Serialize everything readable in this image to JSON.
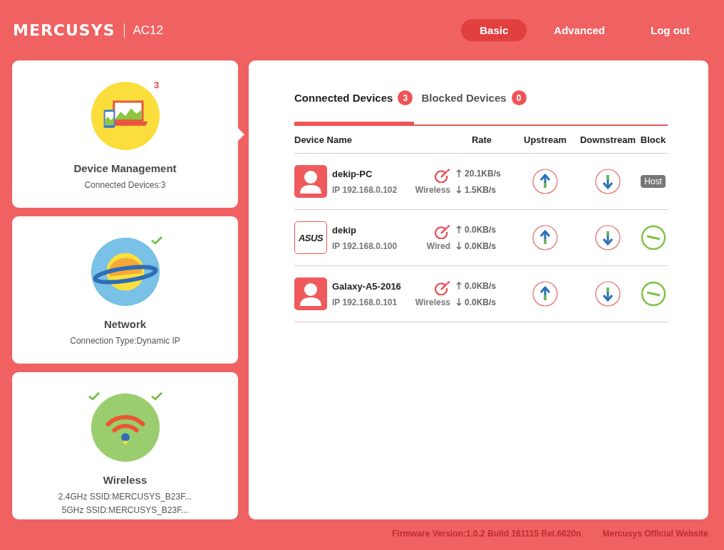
{
  "header": {
    "logo": "MERCUSYS",
    "model": "AC12",
    "nav": [
      {
        "label": "Basic",
        "selected": true
      },
      {
        "label": "Advanced",
        "selected": false
      },
      {
        "label": "Log out",
        "selected": false
      }
    ]
  },
  "cards": [
    {
      "kind": "devices",
      "selected": true,
      "title": "Device Management",
      "lines": [
        "Connected Devices:3"
      ],
      "badges": [
        {
          "kind": "count",
          "text": "3"
        }
      ]
    },
    {
      "kind": "network",
      "selected": false,
      "title": "Network",
      "lines": [
        "Connection Type:Dynamic IP"
      ],
      "badges": [
        {
          "kind": "check"
        }
      ]
    },
    {
      "kind": "wireless",
      "selected": false,
      "title": "Wireless",
      "lines": [
        "2.4GHz SSID:MERCUSYS_B23F...",
        "5GHz SSID:MERCUSYS_B23F..."
      ],
      "badges": [
        {
          "kind": "check"
        },
        {
          "kind": "check"
        }
      ]
    }
  ],
  "tabs": [
    {
      "label": "Connected Devices",
      "count": "3",
      "selected": true
    },
    {
      "label": "Blocked Devices",
      "count": "0",
      "selected": false
    }
  ],
  "table": {
    "columns": [
      "Device Name",
      "Rate",
      "Upstream",
      "Downstream",
      "Block"
    ],
    "rows": [
      {
        "avatar": {
          "kind": "person"
        },
        "name": "dekip-PC",
        "ip": "IP 192.168.0.102",
        "connection": "Wireless",
        "up": "20.1KB/s",
        "down": "1.5KB/s",
        "block": {
          "kind": "host",
          "label": "Host"
        }
      },
      {
        "avatar": {
          "kind": "logo",
          "text": "ASUS"
        },
        "name": "dekip",
        "ip": "IP 192.168.0.100",
        "connection": "Wired",
        "up": "0.0KB/s",
        "down": "0.0KB/s",
        "block": {
          "kind": "button"
        }
      },
      {
        "avatar": {
          "kind": "person"
        },
        "name": "Galaxy-A5-2016",
        "ip": "IP 192.168.0.101",
        "connection": "Wireless",
        "up": "0.0KB/s",
        "down": "0.0KB/s",
        "block": {
          "kind": "button"
        }
      }
    ]
  },
  "footer": {
    "firmware": "Firmware Version:1.0.2 Build 161115 Rel.6620n",
    "website": "Mercusys Official Website"
  }
}
